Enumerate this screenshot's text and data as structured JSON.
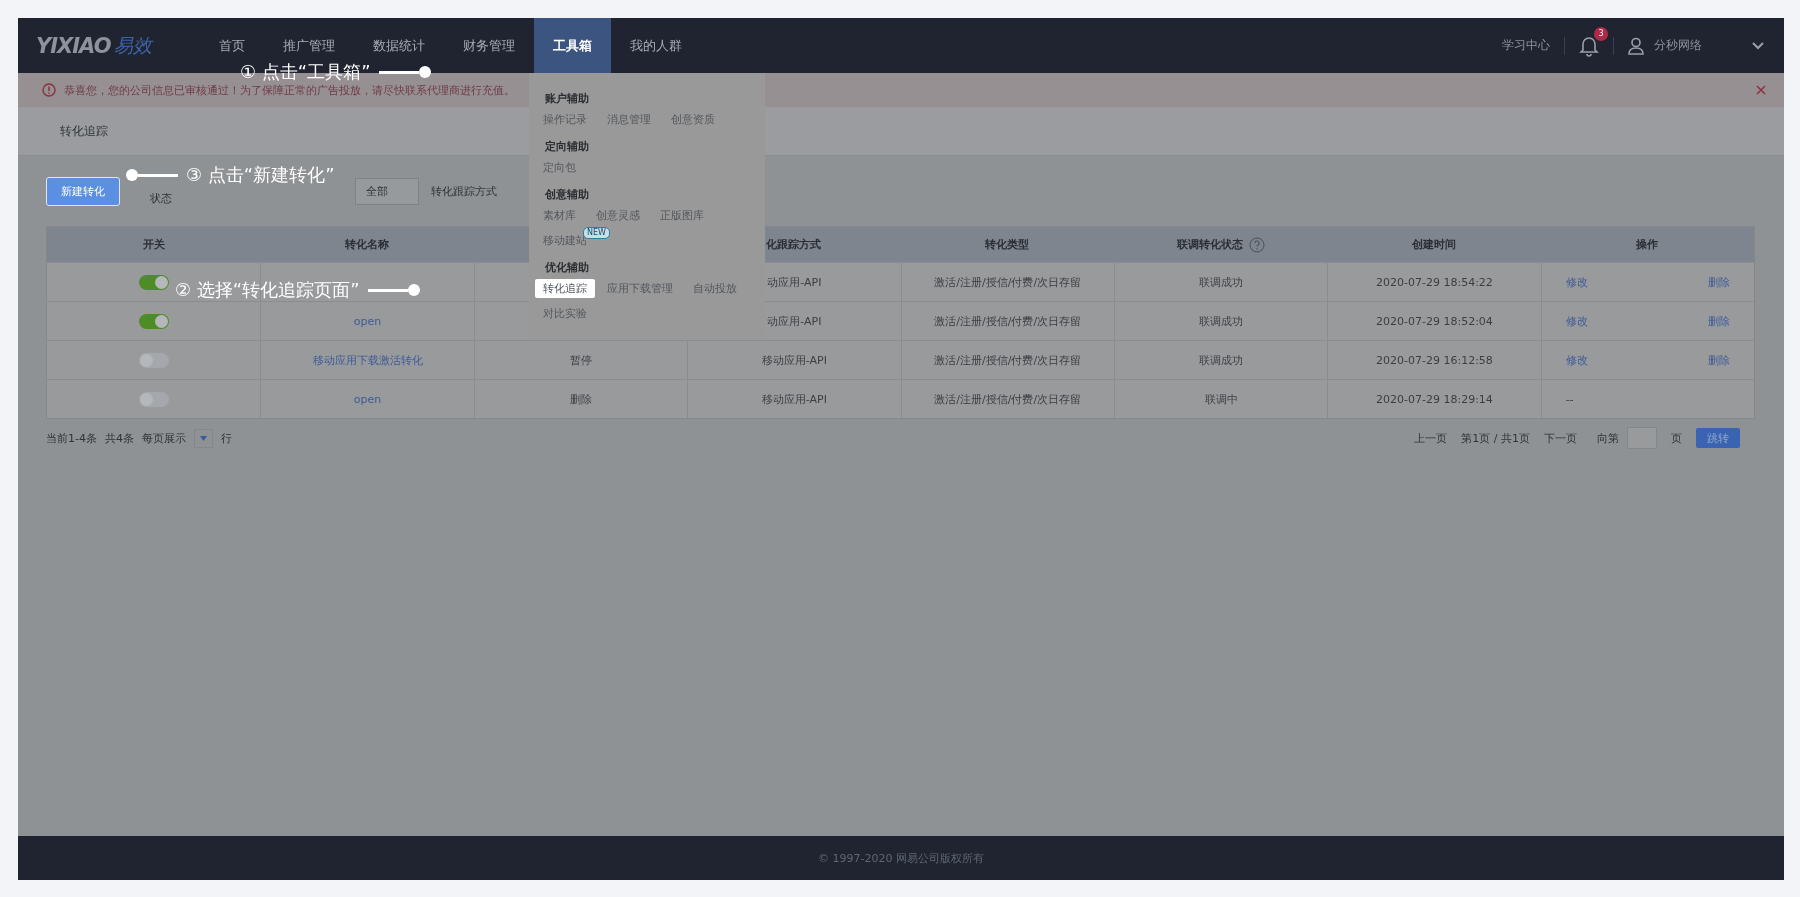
{
  "topbar": {
    "logo_text": "YIXIAO",
    "logo_accent": "易效",
    "nav": [
      {
        "label": "首页",
        "selected": false
      },
      {
        "label": "推广管理",
        "selected": false
      },
      {
        "label": "数据统计",
        "selected": false
      },
      {
        "label": "财务管理",
        "selected": false
      },
      {
        "label": "工具箱",
        "selected": true
      },
      {
        "label": "我的人群",
        "selected": false
      }
    ],
    "help_link": "学习中心",
    "notification_count": "3",
    "user_name": "分秒网络"
  },
  "alert": {
    "text": "恭喜您，您的公司信息已审核通过！为了保障正常的广告投放，请尽快联系代理商进行充值。"
  },
  "breadcrumb": "转化追踪",
  "toolbar": {
    "new_button": "新建转化",
    "status_label": "状态",
    "status_value": "全部",
    "method_label": "转化跟踪方式"
  },
  "table": {
    "columns": [
      {
        "label": "开关"
      },
      {
        "label": "转化名称"
      },
      {},
      {
        "label": "化跟踪方式"
      },
      {
        "label": "转化类型"
      },
      {
        "label": "联调转化状态",
        "help": true
      },
      {
        "label": "创建时间"
      },
      {
        "label": "操作"
      }
    ],
    "rows": [
      {
        "on": true,
        "method": "动应用-API",
        "type": "激活/注册/授信/付费/次日存留",
        "debug": "联调成功",
        "created": "2020-07-29 18:54:22",
        "actions": [
          "修改",
          "删除"
        ]
      },
      {
        "on": true,
        "name": "open",
        "method": "动应用-API",
        "type": "激活/注册/授信/付费/次日存留",
        "debug": "联调成功",
        "created": "2020-07-29 18:52:04",
        "actions": [
          "修改",
          "删除"
        ]
      },
      {
        "on": false,
        "name": "移动应用下载激活转化",
        "state": "暂停",
        "method": "移动应用-API",
        "type": "激活/注册/授信/付费/次日存留",
        "debug": "联调成功",
        "created": "2020-07-29 16:12:58",
        "actions": [
          "修改",
          "删除"
        ]
      },
      {
        "on": false,
        "name": "open",
        "state": "删除",
        "method": "移动应用-API",
        "type": "激活/注册/授信/付费/次日存留",
        "debug": "联调中",
        "created": "2020-07-29 18:29:14",
        "actions_empty": "--"
      }
    ]
  },
  "pagination": {
    "range": "当前1-4条",
    "total": "共4条",
    "per_page_label": "每页展示",
    "per_page_unit": "行",
    "prev": "上一页",
    "page_info": "第1页 / 共1页",
    "next": "下一页",
    "goto_label": "向第",
    "goto_unit": "页",
    "goto_button": "跳转"
  },
  "dropdown_menu": {
    "groups": [
      {
        "title": "账户辅助",
        "items": [
          {
            "label": "操作记录",
            "selected": false
          },
          {
            "label": "消息管理",
            "selected": false
          },
          {
            "label": "创意资质",
            "selected": false
          }
        ]
      },
      {
        "title": "定向辅助",
        "items": [
          {
            "label": "定向包",
            "selected": false
          }
        ]
      },
      {
        "title": "创意辅助",
        "items": [
          {
            "label": "素材库",
            "selected": false
          },
          {
            "label": "创意灵感",
            "selected": false
          },
          {
            "label": "正版图库",
            "selected": false
          },
          {
            "label": "移动建站",
            "selected": false,
            "badge": "NEW"
          }
        ]
      },
      {
        "title": "优化辅助",
        "items": [
          {
            "label": "转化追踪",
            "selected": true
          },
          {
            "label": "应用下载管理",
            "selected": false
          },
          {
            "label": "自动投放",
            "selected": false
          },
          {
            "label": "对比实验",
            "selected": false
          }
        ]
      }
    ]
  },
  "callouts": [
    {
      "text": "① 点击“工具箱”",
      "kind": "right"
    },
    {
      "text": "③ 点击“新建转化”",
      "kind": "left"
    },
    {
      "text": "② 选择“转化追踪页面”",
      "kind": "right"
    }
  ],
  "footer": "© 1997-2020 网易公司版权所有"
}
